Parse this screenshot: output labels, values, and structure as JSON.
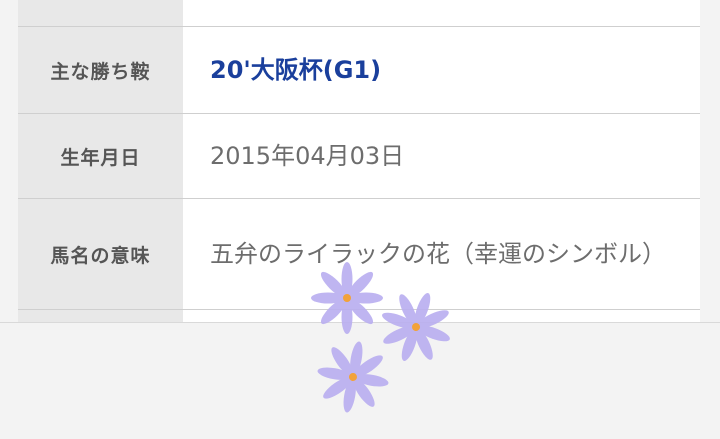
{
  "profile_table": {
    "rows": [
      {
        "label": "主な勝ち鞍",
        "value": "20'大阪杯(G1)"
      },
      {
        "label": "生年月日",
        "value": "2015年04月03日"
      },
      {
        "label": "馬名の意味",
        "value": "五弁のライラックの花（幸運のシンボル）"
      }
    ]
  },
  "decoration": {
    "flower_count": 3,
    "petal_color": "#b9aef0",
    "center_color": "#f2a23a"
  },
  "colors": {
    "link": "#1a3f9c",
    "label_bg": "#e8e8e8",
    "value_text": "#6d6d6d"
  }
}
